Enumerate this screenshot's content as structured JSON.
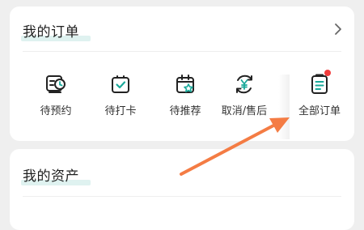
{
  "orders": {
    "title": "我的订单",
    "items": [
      {
        "label": "待预约",
        "icon": "calendar-clock-icon"
      },
      {
        "label": "待打卡",
        "icon": "checkin-bag-icon"
      },
      {
        "label": "待推荐",
        "icon": "calendar-star-icon"
      },
      {
        "label": "取消/售后",
        "icon": "refund-yen-icon"
      },
      {
        "label": "全部订单",
        "icon": "order-list-icon",
        "has_badge": true
      }
    ]
  },
  "assets": {
    "title": "我的资产"
  },
  "colors": {
    "accent_underline": "#dff2f0",
    "teal": "#1aa99a",
    "badge_red": "#f23d3d",
    "arrow_orange": "#f47c44"
  }
}
